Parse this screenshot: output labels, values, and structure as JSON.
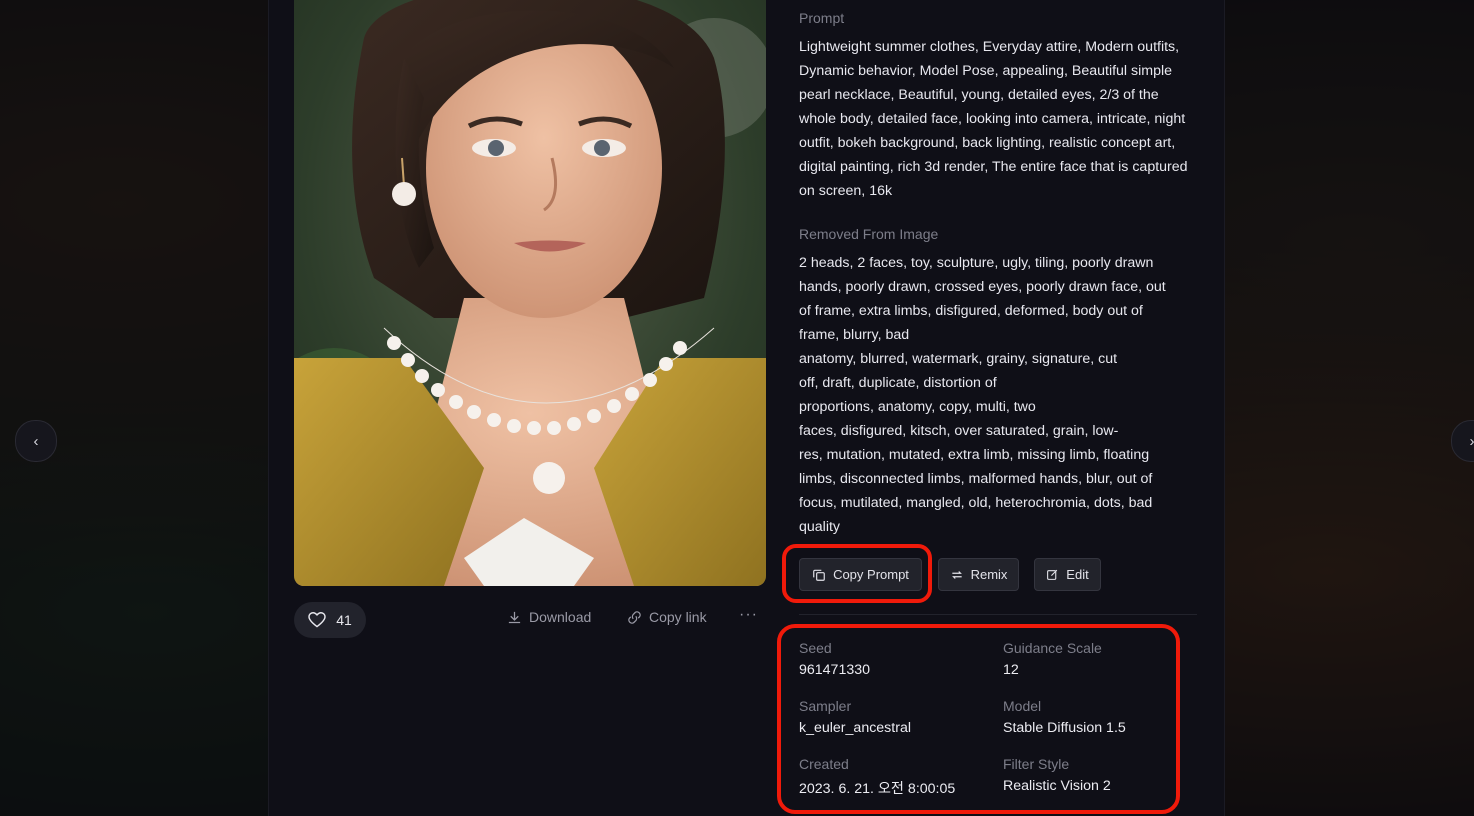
{
  "image": {
    "alt": "Portrait of a young woman with short dark hair, pearl earrings and pearl necklace, wearing a yellow jacket"
  },
  "actions": {
    "like_count": "41",
    "download_label": "Download",
    "copy_link_label": "Copy link",
    "more_label": "···"
  },
  "prompt": {
    "label": "Prompt",
    "text": "Lightweight summer clothes, Everyday attire, Modern outfits, Dynamic behavior, Model Pose, appealing, Beautiful simple pearl necklace, Beautiful, young, detailed eyes, 2/3 of the whole body, detailed face, looking into camera, intricate, night outfit, bokeh background, back lighting, realistic concept art, digital painting, rich 3d render, The entire face that is captured on screen, 16k"
  },
  "removed": {
    "label": "Removed From Image",
    "lines": [
      "2 heads, 2 faces, toy, sculpture, ugly, tiling, poorly drawn",
      "hands, poorly drawn, crossed eyes, poorly drawn face, out",
      "of frame, extra limbs, disfigured, deformed, body out of",
      "frame, blurry, bad",
      "anatomy, blurred, watermark, grainy, signature, cut",
      "off, draft, duplicate, distortion of",
      "proportions, anatomy, copy, multi, two",
      "faces, disfigured, kitsch, over saturated, grain, low-",
      "res, mutation, mutated, extra limb, missing limb, floating",
      "limbs, disconnected limbs, malformed hands, blur, out of",
      "focus, mutilated, mangled, old, heterochromia, dots, bad",
      "quality"
    ]
  },
  "buttons": {
    "copy_prompt": "Copy Prompt",
    "remix": "Remix",
    "edit": "Edit"
  },
  "meta": {
    "seed_label": "Seed",
    "seed": "961471330",
    "guidance_label": "Guidance Scale",
    "guidance": "12",
    "sampler_label": "Sampler",
    "sampler": "k_euler_ancestral",
    "model_label": "Model",
    "model": "Stable Diffusion 1.5",
    "created_label": "Created",
    "created": "2023. 6. 21. 오전 8:00:05",
    "filter_label": "Filter Style",
    "filter": "Realistic Vision 2"
  },
  "colors": {
    "highlight": "#f01a0a",
    "panel": "#0f0f17"
  }
}
